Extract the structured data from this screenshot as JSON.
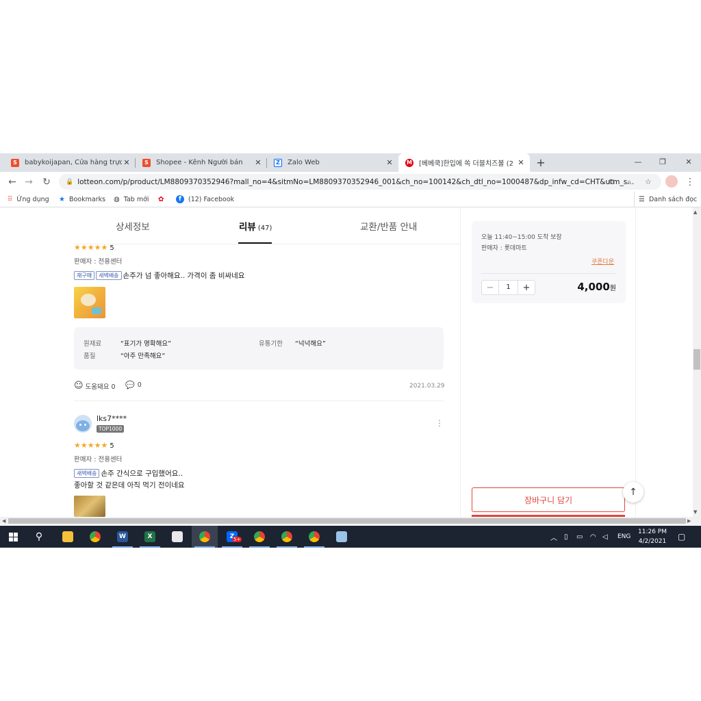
{
  "browser": {
    "tabs": [
      {
        "title": "babykoijapan, Cửa hàng trực tuyế",
        "favicon": "shopee-icon",
        "color": "#ee4d2d"
      },
      {
        "title": "Shopee - Kênh Người bán",
        "favicon": "shopee-icon",
        "color": "#ee4d2d"
      },
      {
        "title": "Zalo Web",
        "favicon": "zalo-icon",
        "color": "#0068ff"
      },
      {
        "title": "[베베쿡]한입에 쏙 더블치즈볼 (2",
        "favicon": "lotteon-icon",
        "color": "#e60012"
      }
    ],
    "close_glyph": "✕",
    "new_tab_glyph": "+",
    "url": "lotteon.com/p/product/LM8809370352946?mall_no=4&sitmNo=LM8809370352946_001&ch_no=100142&ch_dtl_no=1000487&dp_infw_cd=CHT&utm_s...",
    "bookmarks": [
      {
        "label": "Ứng dụng",
        "icon": "apps-grid-icon"
      },
      {
        "label": "Bookmarks",
        "icon": "star-icon"
      },
      {
        "label": "Tab mới",
        "icon": "globe-icon"
      },
      {
        "label": "",
        "icon": "flower-icon"
      },
      {
        "label": "(12) Facebook",
        "icon": "facebook-icon"
      }
    ],
    "reading_list": "Danh sách đọc"
  },
  "product_tabs": {
    "detail": "상세정보",
    "review": "리뷰",
    "review_count": "(47)",
    "exchange": "교환/반품 안내"
  },
  "review1": {
    "rating": "5",
    "seller": "판매자 : 전용센터",
    "badges": [
      "재구매",
      "새벽배송"
    ],
    "text": "손주가 넘 좋아해요.. 가격이 좀 비싸네요",
    "attributes": {
      "label1": "원재료",
      "value1": "“표기가 명확해요”",
      "label2": "유통기한",
      "value2": "“넉넉해요”",
      "label3": "품질",
      "value3": "“아주 만족해요”"
    },
    "helpful": "도움돼요 0",
    "comments": "0",
    "date": "2021.03.29"
  },
  "review2": {
    "username": "lks7****",
    "rank_badge": "TOP1000",
    "rating": "5",
    "seller": "판매자 : 전용센터",
    "badges": [
      "새벽배송"
    ],
    "text_line1": "손주 간식으로 구입했어요..",
    "text_line2": "좋아할 것 같은데 아직 먹기 전이네요"
  },
  "sidebar": {
    "delivery": "오늘 11:40~15:00 도착 보장",
    "seller": "판매자 : 롯데마트",
    "coupon": "쿠폰다운",
    "quantity": "1",
    "minus": "−",
    "plus": "+",
    "price": "4,000",
    "currency": "원",
    "cart_button": "장바구니 담기"
  },
  "taskbar": {
    "lang": "ENG",
    "time": "11:26 PM",
    "date": "4/2/2021",
    "zalo_badge": "5+"
  },
  "colors": {
    "accent_red": "#e0463d",
    "star": "#f5a623",
    "coupon": "#e27a3f",
    "taskbar": "#1c2331"
  }
}
